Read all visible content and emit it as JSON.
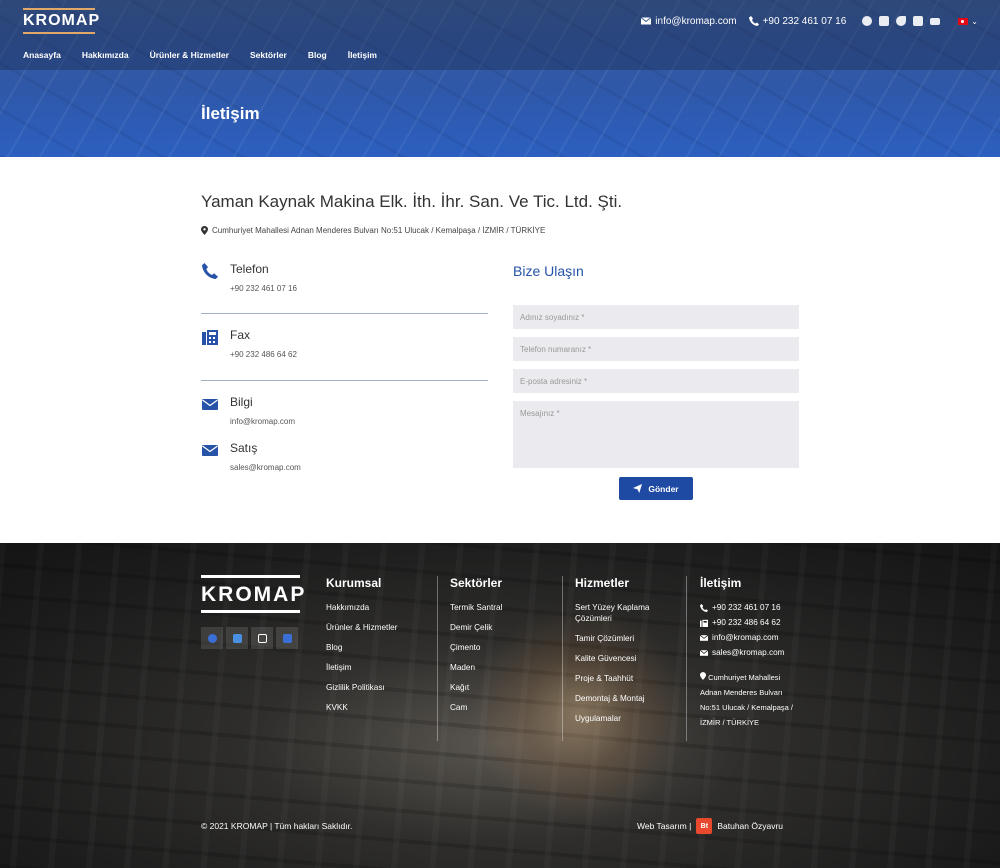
{
  "header": {
    "logo_text": "KROMAP",
    "email": "info@kromap.com",
    "phone": "+90 232 461 07 16",
    "nav": [
      "Anasayfa",
      "Hakkımızda",
      "Ürünler & Hizmetler",
      "Sektörler",
      "Blog",
      "İletişim"
    ],
    "social": [
      "facebook-icon",
      "instagram-icon",
      "twitter-icon",
      "linkedin-icon",
      "youtube-icon"
    ],
    "language_flag": "turkey-flag-icon"
  },
  "page_title": "İletişim",
  "company": {
    "name": "Yaman Kaynak Makina Elk. İth. İhr. San. Ve Tic. Ltd. Şti.",
    "address": "Cumhuriyet Mahallesi Adnan Menderes Bulvarı No:51 Ulucak / Kemalpaşa / İZMİR / TÜRKİYE"
  },
  "contacts": {
    "phone": {
      "title": "Telefon",
      "value": "+90 232 461 07 16"
    },
    "fax": {
      "title": "Fax",
      "value": "+90 232 486 64 62"
    },
    "info": {
      "title": "Bilgi",
      "value": "info@kromap.com"
    },
    "sales": {
      "title": "Satış",
      "value": "sales@kromap.com"
    }
  },
  "form": {
    "title": "Bize Ulaşın",
    "name_placeholder": "Adınız soyadınız *",
    "phone_placeholder": "Telefon numaranız *",
    "email_placeholder": "E-posta adresiniz *",
    "message_placeholder": "Mesajınız *",
    "submit": "Gönder"
  },
  "footer": {
    "logo_text": "KROMAP",
    "kurumsal": {
      "title": "Kurumsal",
      "items": [
        "Hakkımızda",
        "Ürünler & Hizmetler",
        "Blog",
        "İletişim",
        "Gizlilik Politikası",
        "KVKK"
      ]
    },
    "sektorler": {
      "title": "Sektörler",
      "items": [
        "Termik Santral",
        "Demir Çelik",
        "Çimento",
        "Maden",
        "Kağıt",
        "Cam"
      ]
    },
    "hizmetler": {
      "title": "Hizmetler",
      "items": [
        "Sert Yüzey Kaplama Çözümleri",
        "Tamir Çözümleri",
        "Kalite Güvencesi",
        "Proje & Taahhüt",
        "Demontaj & Montaj",
        "Uygulamalar"
      ]
    },
    "iletisim": {
      "title": "İletişim",
      "phone": "+90 232 461 07 16",
      "fax": "+90 232 486 64 62",
      "email": "info@kromap.com",
      "sales": "sales@kromap.com",
      "address": "Cumhuriyet Mahallesi Adnan Menderes Bulvarı No:51 Ulucak / Kemalpaşa / İZMİR / TÜRKİYE"
    },
    "copyright": "© 2021 KROMAP | Tüm hakları Saklıdır.",
    "credit_label": "Web Tasarım |",
    "credit_badge": "Bt",
    "credit_name": "Batuhan Özyavru"
  },
  "colors": {
    "accent": "#2653a8",
    "button": "#1f4aa4",
    "logo_gold": "#e0a968"
  }
}
